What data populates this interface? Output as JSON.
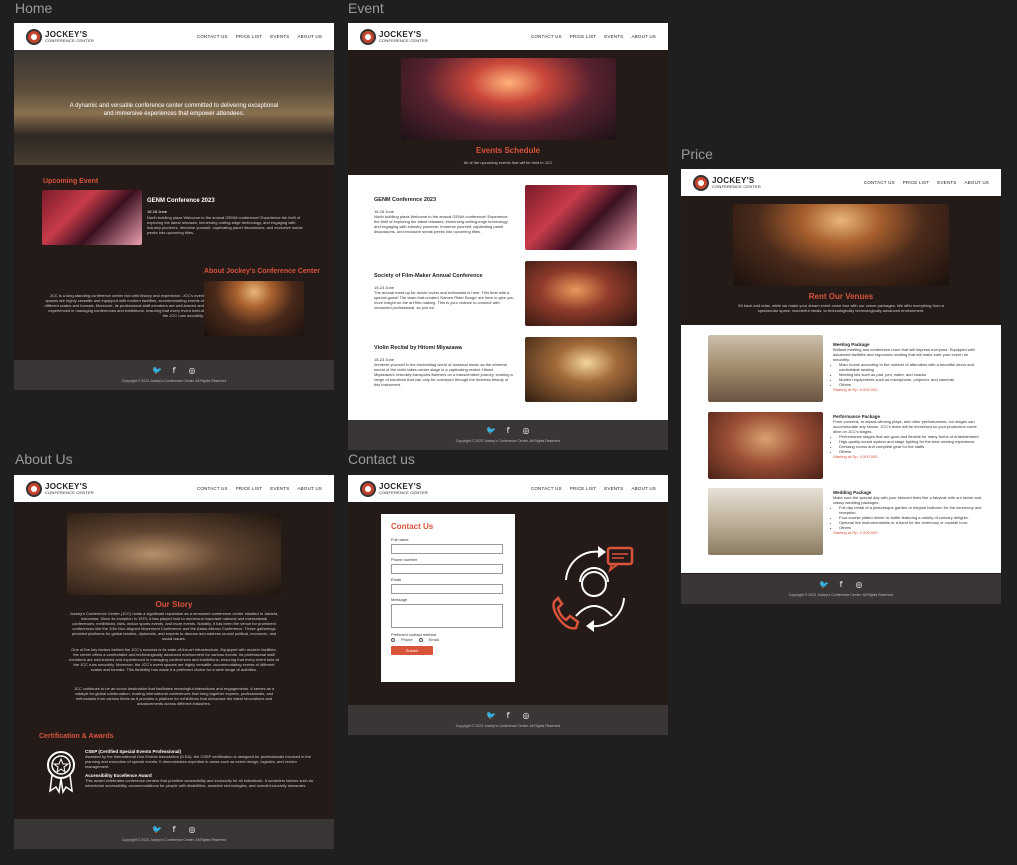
{
  "frames": {
    "home": "Home",
    "event": "Event",
    "price": "Price",
    "about": "About Us",
    "contact": "Contact us"
  },
  "nav": {
    "brand": "JOCKEY'S",
    "brand_sub": "CONFERENCE CENTER",
    "links": [
      "CONTACT US",
      "PRICE LIST",
      "EVENTS",
      "ABOUT US"
    ]
  },
  "footer": {
    "copyright": "Copyright © 2023 Jockey's Conference Center. All Rights Reserved"
  },
  "home": {
    "hero_text": "A dynamic and versatile conference center committed to delivering exceptional and immersive experiences that empower attendees.",
    "upcoming_title": "Upcoming Event",
    "event_title": "GENM Conference 2023",
    "event_date": "16-18 June",
    "event_desc": "North building plaza Welcome to the annual GENM conference! Experience the thrill of exploring the latest releases, immersing cutting-edge technology, and engaging with industry pioneers. Immerse yourself, captivating panel discussions, and exclusive sneak peeks into upcoming titles.",
    "about_title": "About Jockey's Conference Center",
    "about_desc": "JCC is a long-standing conference center rich with history and experience. JCC's event spaces are highly versatile and equipped with modern facilities, accommodating events of different scales and formats. Moreover, its professional staff members are well-trained and experienced in managing conferences and exhibitions, ensuring that every event held at the JCC runs smoothly."
  },
  "event": {
    "title": "Events Schedule",
    "subtitle": "All of the upcoming events that will be held in JCC",
    "items": [
      {
        "title": "GENM Conference 2023",
        "date": "16-18 June",
        "desc": "North building plaza Welcome to the annual GENM conference! Experience the thrill of exploring the latest releases, immersing cutting-edge technology, and engaging with industry pioneers. Immerse yourself, captivating panel discussions, and exclusive sneak peeks into upcoming titles."
      },
      {
        "title": "Society of Film-Maker Annual Conference",
        "date": "19-23 June",
        "desc": "The annual meet-up for movie lovers and enthusiast is here. This time with a special guest! The team that created 'Kamen Rider Busgo' are here to give you more insight on the art film-making. This is your chance to connect with renowned professional, so join us!"
      },
      {
        "title": "Violin Recital by Hitomi Miyazawa",
        "date": "18-23 June",
        "desc": "Immerse yourself in the enchanting world of classical music as the ethereal sound of the violin takes center stage in a captivating recital. Hitomi Miyazawa's virtuosity transports listeners on a transcendent journey, evoking a range of emotions that can only be conveyed through the timeless beauty of this instrument."
      }
    ]
  },
  "price": {
    "title": "Rent Our Venues",
    "subtitle": "Sit back and relax, while we make your dream event come true with our venue packages. We offer everything from a spectacular space, wonderful meals, to technologically technologically advanced environment.",
    "packages": [
      {
        "name": "Meeting Package",
        "desc": "Brilliant meeting and conference room that will impress everyone. Equipped with advanced facilities and ergonomic seating that will make sure your event run smoothly.",
        "features": [
          "Main rooms according to the number of attendees with a beautiful decor and comfortable seating",
          "Meeting kits such as pad, pen, water, and snacks",
          "Modern equipments such as microphone, projector, and cameras",
          "Others"
        ],
        "price": "Starting at Rp. 5.000.000"
      },
      {
        "name": "Performance Package",
        "desc": "From concerts, to award-winning plays, and other performances, our stages can accommodate any shows. JCC's team will be immersed so your production come alive on JCC's stages.",
        "features": [
          "Performance stages that are good and flexible for many forms of entertainment",
          "High-quality sound system and stage lighting for the best viewing experience",
          "Dressing rooms and complete gear for the staffs",
          "Others"
        ],
        "price": "Starting at Rp. 4.500.000"
      },
      {
        "name": "Wedding Package",
        "desc": "Make sure the special day with your beloved feels like a fairytale with our lavish and classy wedding packages.",
        "features": [
          "Full day rental of a picturesque garden or elegant ballroom for the ceremony and reception.",
          "Four-course plated dinner or buffet featuring a variety of culinary delights.",
          "Optional live instrumentalists or a band for the ceremony or cocktail hour.",
          "Others"
        ],
        "price": "Starting at Rp. 2.000.000"
      }
    ]
  },
  "about": {
    "story_title": "Our Story",
    "p1": "Jockey's Conference Center (JCC) holds a significant reputation as a renowned conference center situated in Jakarta, Indonesia. Since its inception in 1970, it has played host to numerous important national and international conferences, exhibitions, fairs, indoor sports events, and more events. Notably, it has been the venue for prominent conferences like the 10th Non-Aligned Movement Conference and the Asian-African Conference. These gatherings provided platforms for global leaders, diplomats, and experts to discuss and address crucial political, economic, and social issues.",
    "p2": "One of the key factors behind the JCC's success is its state-of-the-art infrastructure. Equipped with modern facilities, the center offers a comfortable and technologically advanced environment for various events. Its professional staff members are well-trained and experienced in managing conferences and exhibitions, ensuring that every event held at the JCC runs smoothly. Moreover, the JCC's event spaces are highly versatile, accommodating events of different scales and formats. This flexibility has made it a preferred choice for a wide range of activities.",
    "p3": "JCC continues to be an iconic destination that facilitates meaningful interactions and engagements. It serves as a catalyst for global collaboration, hosting international conferences that bring together experts, professionals, and enthusiasts from various fields as it provides a platform for exhibitions that showcase the latest innovations and advancements across different industries.",
    "cert_title": "Certification & Awards",
    "cert1_title": "CSEP (Certified Special Events Professional)",
    "cert1_desc": "Awarded by the International Live Events Association (ILEA), the CSEP certification is designed for professionals involved in the planning and execution of special events. It demonstrates expertise in areas such as event design, logistics, and vendor management.",
    "cert2_title": "Accessibility Excellence Award",
    "cert2_desc": "This award celebrates conference centers that prioritize accessibility and inclusivity for all individuals. It considers factors such as wheelchair accessibility, accommodations for people with disabilities, assistive technologies, and overall inclusivity measures."
  },
  "contact": {
    "title": "Contact Us",
    "full_name": "Full name",
    "phone": "Phone number",
    "email": "Email",
    "message": "Message",
    "preferred": "Preferred contact method",
    "opt_phone": "Phone",
    "opt_email": "Email",
    "submit": "Submit"
  }
}
